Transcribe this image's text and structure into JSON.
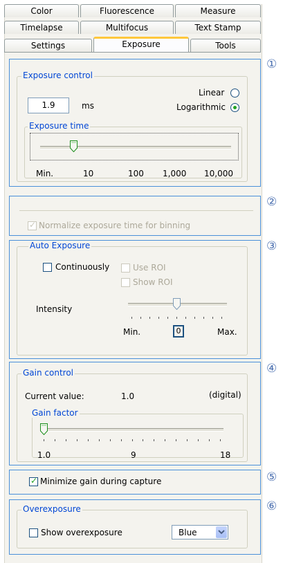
{
  "tabs": {
    "row1": [
      "Color",
      "Fluorescence",
      "Measure"
    ],
    "row2": [
      "Timelapse",
      "Multifocus",
      "Text Stamp"
    ],
    "row3": [
      "Settings",
      "Exposure",
      "Tools"
    ],
    "active": "Exposure"
  },
  "callouts": [
    "①",
    "②",
    "③",
    "④",
    "⑤",
    "⑥"
  ],
  "exposure_control": {
    "title": "Exposure control",
    "value": "1.9",
    "unit": "ms",
    "linear_label": "Linear",
    "log_label": "Logarithmic",
    "mode_selected": "Logarithmic",
    "exposure_time": {
      "title": "Exposure time",
      "ticks": [
        "Min.",
        "10",
        "100",
        "1,000",
        "10,000"
      ],
      "level": 0.15
    }
  },
  "binning": {
    "label": "Normalize exposure time for binning",
    "checked": true,
    "disabled": true
  },
  "auto_exposure": {
    "title": "Auto Exposure",
    "continuously_label": "Continuously",
    "use_roi_label": "Use ROI",
    "show_roi_label": "Show ROI",
    "intensity_label": "Intensity",
    "min_label": "Min.",
    "max_label": "Max.",
    "value": "0",
    "level": 0.5
  },
  "gain_control": {
    "title": "Gain control",
    "current_label": "Current value:",
    "current_value": "1.0",
    "type": "(digital)",
    "gain_factor": {
      "title": "Gain factor",
      "ticks": [
        "1.0",
        "9",
        "18"
      ],
      "level": 0.0
    }
  },
  "minimize_gain": {
    "label": "Minimize gain during capture",
    "checked": true
  },
  "overexposure": {
    "title": "Overexposure",
    "show_label": "Show overexposure",
    "color": "Blue"
  },
  "colors": {
    "accent": "#0046d5",
    "section_border": "#4a90d9",
    "check_green": "#21a121",
    "active_tab_top": "#ffc83c"
  }
}
